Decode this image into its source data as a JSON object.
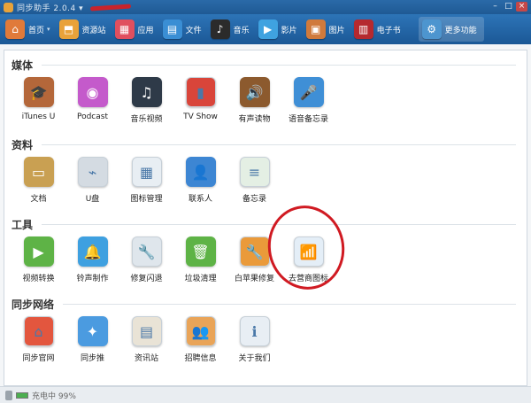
{
  "window": {
    "title": "同步助手 2.0.4 ▾"
  },
  "toolbar": {
    "items": [
      {
        "label": "首页",
        "icon": "home-icon",
        "color": "#e07a3a",
        "glyph": "⌂"
      },
      {
        "label": "资源站",
        "icon": "store-icon",
        "color": "#e9a23a",
        "glyph": "⬒"
      },
      {
        "label": "应用",
        "icon": "apps-icon",
        "color": "#e04f5f",
        "glyph": "▦"
      },
      {
        "label": "文件",
        "icon": "file-icon",
        "color": "#3a8ed4",
        "glyph": "▤"
      },
      {
        "label": "音乐",
        "icon": "music-icon",
        "color": "#2b2b2b",
        "glyph": "♪"
      },
      {
        "label": "影片",
        "icon": "video-icon",
        "color": "#3fa2e0",
        "glyph": "▶"
      },
      {
        "label": "图片",
        "icon": "picture-icon",
        "color": "#d07a3c",
        "glyph": "▣"
      },
      {
        "label": "电子书",
        "icon": "ebook-icon",
        "color": "#b5292f",
        "glyph": "▥"
      },
      {
        "label": "更多功能",
        "icon": "more-icon",
        "color": "#4d95cf",
        "glyph": "⚙"
      }
    ],
    "home_caret": "▾"
  },
  "sections": {
    "media": {
      "title": "媒体",
      "tiles": [
        {
          "label": "iTunes U",
          "icon": "itunes-u-icon",
          "color": "#b4673a",
          "glyph": "🎓"
        },
        {
          "label": "Podcast",
          "icon": "podcast-icon",
          "color": "#c45acb",
          "glyph": "◉"
        },
        {
          "label": "音乐视频",
          "icon": "music-video-icon",
          "color": "#2e3a48",
          "glyph": "♫"
        },
        {
          "label": "TV Show",
          "icon": "tv-show-icon",
          "color": "#d9453a",
          "glyph": "▮"
        },
        {
          "label": "有声读物",
          "icon": "audiobook-icon",
          "color": "#8c5a2e",
          "glyph": "🔊"
        },
        {
          "label": "语音备忘录",
          "icon": "voice-memo-icon",
          "color": "#3f8fd6",
          "glyph": "🎤"
        }
      ]
    },
    "data": {
      "title": "资料",
      "tiles": [
        {
          "label": "文档",
          "icon": "document-icon",
          "color": "#c9a052",
          "glyph": "▭"
        },
        {
          "label": "U盘",
          "icon": "usb-drive-icon",
          "color": "#d4dbe2",
          "glyph": "⌁"
        },
        {
          "label": "图标管理",
          "icon": "icon-manager-icon",
          "color": "#e8eef3",
          "glyph": "▦"
        },
        {
          "label": "联系人",
          "icon": "contacts-icon",
          "color": "#3d86d3",
          "glyph": "👤"
        },
        {
          "label": "备忘录",
          "icon": "notes-icon",
          "color": "#e4efe4",
          "glyph": "≡"
        }
      ]
    },
    "tools": {
      "title": "工具",
      "tiles": [
        {
          "label": "视频转换",
          "icon": "video-convert-icon",
          "color": "#5eb346",
          "glyph": "▶"
        },
        {
          "label": "铃声制作",
          "icon": "ringtone-icon",
          "color": "#3ea0e0",
          "glyph": "🔔"
        },
        {
          "label": "修复闪退",
          "icon": "repair-crash-icon",
          "color": "#dfe6ec",
          "glyph": "🔧"
        },
        {
          "label": "垃圾清理",
          "icon": "trash-cleanup-icon",
          "color": "#5eb346",
          "glyph": "🗑"
        },
        {
          "label": "白苹果修复",
          "icon": "white-apple-fix-icon",
          "color": "#ea9a3a",
          "glyph": "🔧"
        },
        {
          "label": "去营商图标",
          "icon": "carrier-logo-icon",
          "color": "#e4eef7",
          "glyph": "📶"
        }
      ]
    },
    "network": {
      "title": "同步网络",
      "tiles": [
        {
          "label": "同步官网",
          "icon": "official-site-icon",
          "color": "#e3563e",
          "glyph": "⌂"
        },
        {
          "label": "同步推",
          "icon": "sync-push-icon",
          "color": "#4b9be0",
          "glyph": "✦"
        },
        {
          "label": "资讯站",
          "icon": "news-icon",
          "color": "#e9e3d6",
          "glyph": "▤"
        },
        {
          "label": "招聘信息",
          "icon": "jobs-icon",
          "color": "#e9a458",
          "glyph": "👥"
        },
        {
          "label": "关于我们",
          "icon": "about-icon",
          "color": "#e8eef4",
          "glyph": "ℹ"
        }
      ]
    }
  },
  "status": {
    "text": "充电中 99%",
    "battery_level": 0.99
  }
}
